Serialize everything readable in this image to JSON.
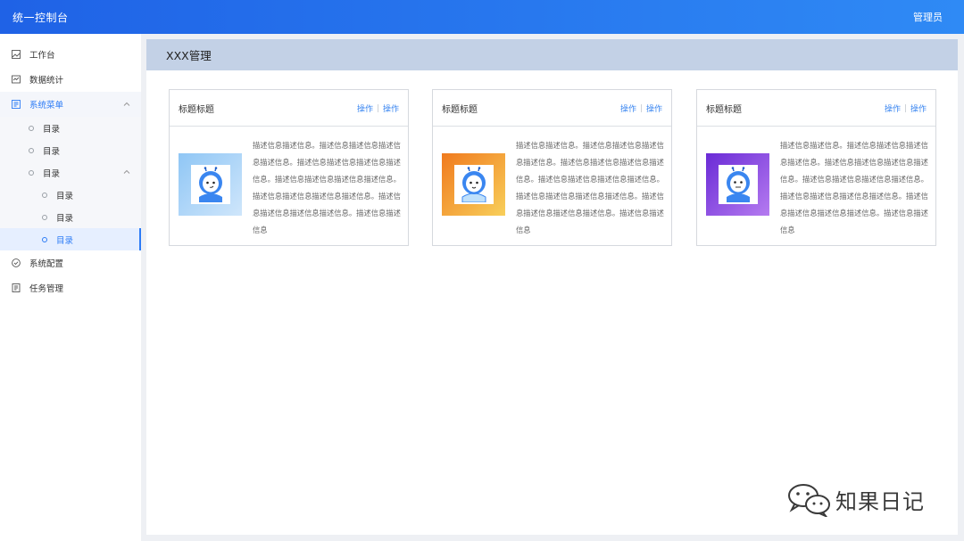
{
  "header": {
    "title": "统一控制台",
    "user": "管理员"
  },
  "sidebar": {
    "items": [
      {
        "label": "工作台",
        "icon": "image-icon"
      },
      {
        "label": "数据统计",
        "icon": "chart-icon"
      },
      {
        "label": "系统菜单",
        "icon": "menu-icon",
        "expanded": true
      },
      {
        "label": "系统配置",
        "icon": "check-circle-icon"
      },
      {
        "label": "任务管理",
        "icon": "document-icon"
      }
    ],
    "submenu": {
      "level1": [
        "目录",
        "目录",
        "目录"
      ],
      "level2": [
        "目录",
        "目录",
        "目录"
      ],
      "active_index": 2
    }
  },
  "page": {
    "title": "XXX管理"
  },
  "cards": [
    {
      "title": "标题标题",
      "action1": "操作",
      "action2": "操作",
      "thumb_gradient": [
        "#8fc6f5",
        "#cfe6fb"
      ],
      "description": "描述信息描述信息。描述信息描述信息描述信息描述信息。描述信息描述信息描述信息描述信息。描述信息描述信息描述信息描述信息。描述信息描述信息描述信息描述信息。描述信息描述信息描述信息描述信息。描述信息描述信息"
    },
    {
      "title": "标题标题",
      "action1": "操作",
      "action2": "操作",
      "thumb_gradient": [
        "#f07a1e",
        "#f8cf5a"
      ],
      "description": "描述信息描述信息。描述信息描述信息描述信息描述信息。描述信息描述信息描述信息描述信息。描述信息描述信息描述信息描述信息。描述信息描述信息描述信息描述信息。描述信息描述信息描述信息描述信息。描述信息描述信息"
    },
    {
      "title": "标题标题",
      "action1": "操作",
      "action2": "操作",
      "thumb_gradient": [
        "#6a2bd6",
        "#b57bf0"
      ],
      "description": "描述信息描述信息。描述信息描述信息描述信息描述信息。描述信息描述信息描述信息描述信息。描述信息描述信息描述信息描述信息。描述信息描述信息描述信息描述信息。描述信息描述信息描述信息描述信息。描述信息描述信息"
    }
  ],
  "watermark": {
    "text": "知果日记"
  },
  "colors": {
    "accent": "#2d7cf6",
    "topbar_start": "#1f62e6",
    "topbar_end": "#2f8af5",
    "page_header_bg": "#c3d1e6"
  }
}
